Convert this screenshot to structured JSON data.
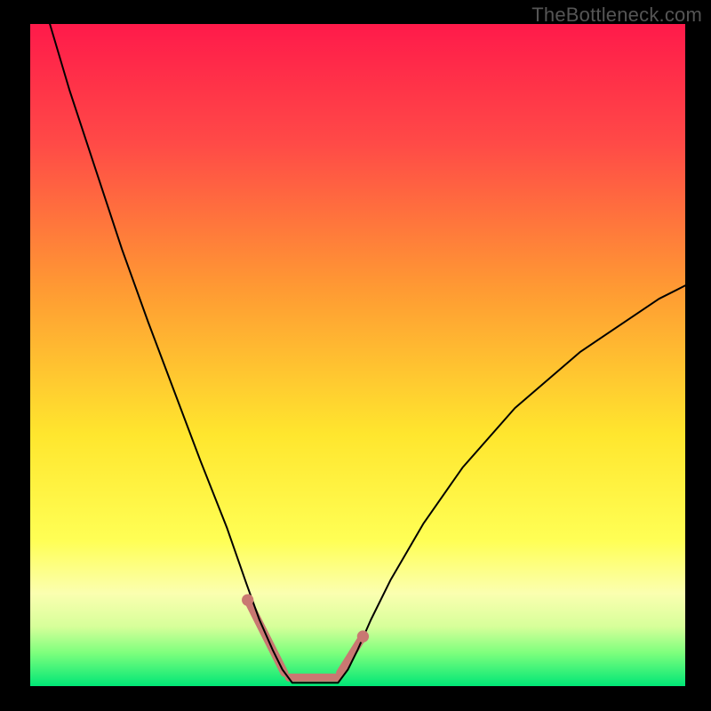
{
  "watermark": "TheBottleneck.com",
  "chart_data": {
    "type": "line",
    "title": "",
    "xlabel": "",
    "ylabel": "",
    "xlim": [
      0,
      100
    ],
    "ylim": [
      0,
      100
    ],
    "grid": false,
    "legend": false,
    "gradient": {
      "stops": [
        {
          "pct": 0,
          "color": "#ff1a4a"
        },
        {
          "pct": 18,
          "color": "#ff4a47"
        },
        {
          "pct": 40,
          "color": "#ff9a33"
        },
        {
          "pct": 62,
          "color": "#ffe62e"
        },
        {
          "pct": 78,
          "color": "#ffff55"
        },
        {
          "pct": 86,
          "color": "#fbffb0"
        },
        {
          "pct": 91,
          "color": "#d7ff9a"
        },
        {
          "pct": 95,
          "color": "#7dff7d"
        },
        {
          "pct": 100,
          "color": "#00e676"
        }
      ]
    },
    "series": [
      {
        "name": "bottleneck-curve",
        "color": "#000000",
        "width": 2,
        "x": [
          3,
          6,
          10,
          14,
          18,
          22,
          26,
          30,
          33,
          35,
          37,
          38.5,
          40,
          47,
          48.5,
          50,
          52,
          55,
          60,
          66,
          74,
          84,
          96,
          100
        ],
        "y": [
          100,
          90,
          78,
          66,
          55,
          44.5,
          34,
          24,
          15.5,
          10,
          5.5,
          2.5,
          0.5,
          0.5,
          2.5,
          5.5,
          10,
          16,
          24.5,
          33,
          42,
          50.5,
          58.5,
          60.5
        ]
      }
    ],
    "valley_markers": {
      "color": "#c97872",
      "radius": 5,
      "highlight_width": 9,
      "left": {
        "x0": 33.2,
        "y0": 13.0,
        "x1": 38.8,
        "y1": 2.0
      },
      "floor": {
        "x0": 39.5,
        "y0": 1.3,
        "x1": 47.0,
        "y1": 1.3
      },
      "right": {
        "x0": 47.3,
        "y0": 2.0,
        "x1": 50.8,
        "y1": 7.5
      }
    }
  }
}
